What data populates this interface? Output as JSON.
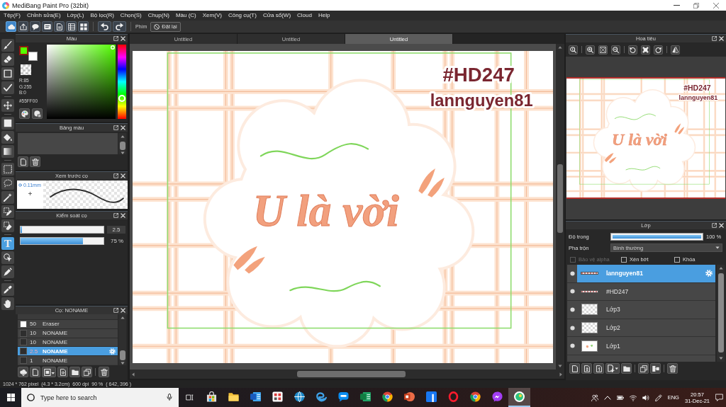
{
  "window": {
    "title": "MediBang Paint Pro (32bit)"
  },
  "menu": [
    "Tệp(F)",
    "Chỉnh sửa(E)",
    "Lớp(L)",
    "Bộ lọc(R)",
    "Chọn(S)",
    "Chụp(N)",
    "Màu (C)",
    "Xem(V)",
    "Công cụ(T)",
    "Cửa sổ(W)",
    "Cloud",
    "Help"
  ],
  "toolbar": {
    "buttons": [
      {
        "kind": "cloud",
        "selected": true
      },
      {
        "kind": "share",
        "selected": false
      },
      {
        "kind": "chat",
        "selected": false
      },
      {
        "kind": "message",
        "selected": false
      },
      {
        "kind": "document",
        "selected": false
      },
      {
        "kind": "table",
        "selected": false
      },
      {
        "kind": "grid",
        "selected": false
      }
    ],
    "history": [
      {
        "kind": "undo"
      },
      {
        "kind": "redo"
      }
    ],
    "shortcut_label": "Phím",
    "reset_button": "Đặt lại"
  },
  "tool_groups": [
    [
      {
        "kind": "brush",
        "selected": false
      },
      {
        "kind": "eraser",
        "selected": false
      },
      {
        "kind": "dot",
        "selected": false
      },
      {
        "kind": "line",
        "selected": false
      }
    ],
    [
      {
        "kind": "move",
        "selected": false
      }
    ],
    [
      {
        "kind": "fill",
        "selected": false
      },
      {
        "kind": "bucket",
        "selected": false
      },
      {
        "kind": "gradient",
        "selected": false
      }
    ],
    [
      {
        "kind": "select",
        "selected": false
      },
      {
        "kind": "lasso",
        "selected": false
      },
      {
        "kind": "wand",
        "selected": false
      },
      {
        "kind": "select-pen",
        "selected": false
      },
      {
        "kind": "select-eraser",
        "selected": false
      }
    ],
    [
      {
        "kind": "text",
        "glyph": "T",
        "selected": true
      },
      {
        "kind": "operation",
        "selected": false
      },
      {
        "kind": "divide",
        "selected": false
      }
    ],
    [
      {
        "kind": "eyedropper",
        "selected": false
      },
      {
        "kind": "hand",
        "selected": false
      }
    ]
  ],
  "color_panel": {
    "title": "Màu",
    "swatches": [
      {
        "color": "#55ff00"
      },
      {
        "color": "#ffffff"
      }
    ],
    "values": [
      "R:85",
      "G:255",
      "B:0"
    ],
    "hex": "#55FF00",
    "hue": {
      "level": 0.28
    },
    "tools": [
      {
        "kind": "palette"
      },
      {
        "kind": "palette-grid"
      }
    ]
  },
  "palette_panel": {
    "title": "Bảng màu",
    "tools": [
      {
        "kind": "new-page"
      },
      {
        "kind": "trash"
      }
    ]
  },
  "brush_preview": {
    "title": "Xem trước cọ",
    "size": "0.11mm"
  },
  "brush_control": {
    "title": "Kiểm soát cọ",
    "sliders": [
      {
        "kind": "size",
        "level": 0.02,
        "reading": "2.5"
      },
      {
        "kind": "opacity",
        "level": 0.75,
        "reading": "75 %"
      }
    ]
  },
  "brush_list": {
    "title": "Cọ: NONAME",
    "rows": [
      {
        "size": "50",
        "name": "Eraser",
        "color": "#ffffff",
        "selected": false
      },
      {
        "size": "10",
        "name": "NONAME",
        "color": "#2e2e2e",
        "selected": false
      },
      {
        "size": "10",
        "name": "NONAME",
        "color": "#2e2e2e",
        "selected": false
      },
      {
        "size": "2.5",
        "name": "NONAME",
        "color": "#2e2e2e",
        "selected": true
      },
      {
        "size": "1",
        "name": "NONAME",
        "color": "#2e2e2e",
        "selected": false
      }
    ],
    "tool_groups": [
      [
        {
          "kind": "cloud-download"
        },
        {
          "kind": "new-page"
        },
        {
          "kind": "brush-menu"
        },
        {
          "kind": "page-settings"
        },
        {
          "kind": "folder"
        },
        {
          "kind": "duplicate"
        }
      ],
      [
        {
          "kind": "trash"
        }
      ]
    ]
  },
  "tabs": [
    {
      "label": "Untitled",
      "selected": false
    },
    {
      "label": "Untitled",
      "selected": false
    },
    {
      "label": "Untitled",
      "selected": true
    }
  ],
  "canvas": {
    "tag": "#HD247",
    "author": "lannguyen81",
    "lettering": "U là vời"
  },
  "navigator": {
    "title": "Hoa tiêu",
    "tool_groups": [
      [
        {
          "kind": "zoom-reset"
        }
      ],
      [
        {
          "kind": "zoom-in"
        },
        {
          "kind": "fit"
        },
        {
          "kind": "zoom-out"
        }
      ],
      [
        {
          "kind": "rotate-left"
        },
        {
          "kind": "fit-window"
        },
        {
          "kind": "rotate-right"
        }
      ],
      [
        {
          "kind": "flip"
        }
      ]
    ],
    "preview": {
      "tag": "#HD247",
      "author": "lannguyen81",
      "lettering": "U là vời"
    }
  },
  "layers_panel": {
    "title": "Lớp",
    "opacity_label": "Độ trong",
    "opacity": {
      "level": 1,
      "reading": "100 %"
    },
    "blend_label": "Pha trộn",
    "blend_mode": "Bình thường",
    "options": [
      {
        "label": "Bảo vệ alpha",
        "checked": false,
        "disabled": true
      },
      {
        "label": "Xén bớt",
        "checked": false,
        "disabled": false
      },
      {
        "label": "Khóa",
        "checked": false,
        "disabled": false
      }
    ],
    "layers": [
      {
        "name": "lannguyen81",
        "kind": "text",
        "visible": true,
        "selected": true
      },
      {
        "name": "#HD247",
        "kind": "text",
        "visible": true,
        "selected": false
      },
      {
        "name": "Lớp3",
        "kind": "empty",
        "visible": true,
        "selected": false
      },
      {
        "name": "Lớp2",
        "kind": "empty",
        "visible": true,
        "selected": false
      },
      {
        "name": "Lớp1",
        "kind": "image",
        "visible": true,
        "selected": false
      }
    ],
    "action_groups": [
      [
        {
          "kind": "new-page"
        },
        {
          "kind": "halftone-layer"
        },
        {
          "kind": "bit-layer"
        },
        {
          "kind": "add-layer"
        },
        {
          "kind": "folder"
        }
      ],
      [
        {
          "kind": "duplicate"
        },
        {
          "kind": "merge"
        }
      ],
      [
        {
          "kind": "trash"
        }
      ]
    ]
  },
  "status_bar": [
    "1024 * 762 pixel",
    "(4.3 * 3.2cm)",
    "600 dpi",
    "90 %",
    "( 642, 396 )"
  ],
  "taskbar": {
    "search": {
      "placeholder": "Type here to search"
    },
    "apps": [
      {
        "kind": "store",
        "selected": false
      },
      {
        "kind": "files",
        "selected": false
      },
      {
        "kind": "word",
        "selected": false
      },
      {
        "kind": "pattern-app",
        "selected": false
      },
      {
        "kind": "globe-app",
        "selected": false
      },
      {
        "kind": "edge",
        "selected": false
      },
      {
        "kind": "chat-app",
        "selected": false
      },
      {
        "kind": "excel",
        "selected": false
      },
      {
        "kind": "chrome",
        "selected": false
      },
      {
        "kind": "powerpoint",
        "selected": false
      },
      {
        "kind": "facebook",
        "selected": false
      },
      {
        "kind": "opera",
        "selected": false
      },
      {
        "kind": "chrome",
        "selected": false
      },
      {
        "kind": "messenger",
        "selected": false
      },
      {
        "kind": "medibang",
        "selected": true
      }
    ],
    "tray": [
      {
        "kind": "people"
      },
      {
        "kind": "caret-up"
      },
      {
        "kind": "battery"
      },
      {
        "kind": "wifi"
      },
      {
        "kind": "volume"
      },
      {
        "kind": "pen"
      }
    ],
    "language": "ENG",
    "time": "20:57",
    "date": "31-Dec-21"
  }
}
